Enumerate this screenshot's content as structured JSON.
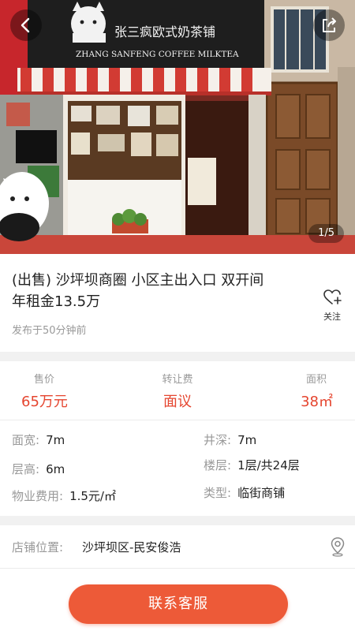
{
  "gallery": {
    "shop_sign_cn": "张三疯欧式奶茶铺",
    "shop_sign_en": "ZHANG SANFENG COFFEE MILKTEA",
    "counter": "1/5"
  },
  "listing": {
    "title": "(出售) 沙坪坝商圈 小区主出入口 双开间 年租金13.5万",
    "posted": "发布于50分钟前",
    "follow_label": "关注"
  },
  "stats": {
    "price": {
      "label": "售价",
      "value": "65万元"
    },
    "transfer_fee": {
      "label": "转让费",
      "value": "面议"
    },
    "area": {
      "label": "面积",
      "value": "38㎡"
    }
  },
  "specs": {
    "width": {
      "label": "面宽:",
      "value": "7m"
    },
    "depth": {
      "label": "井深:",
      "value": "7m"
    },
    "height": {
      "label": "层高:",
      "value": "6m"
    },
    "floor": {
      "label": "楼层:",
      "value": "1层/共24层"
    },
    "property_fee": {
      "label": "物业费用:",
      "value": "1.5元/㎡"
    },
    "type": {
      "label": "类型:",
      "value": "临街商铺"
    }
  },
  "location": {
    "label": "店铺位置:",
    "value": "沙坪坝区-民安俊浩"
  },
  "actions": {
    "contact_label": "联系客服"
  },
  "colors": {
    "accent": "#e5452f",
    "button": "#ed5a38"
  },
  "icons": [
    "back-arrow-icon",
    "share-icon",
    "heart-plus-icon",
    "location-pin-icon"
  ]
}
